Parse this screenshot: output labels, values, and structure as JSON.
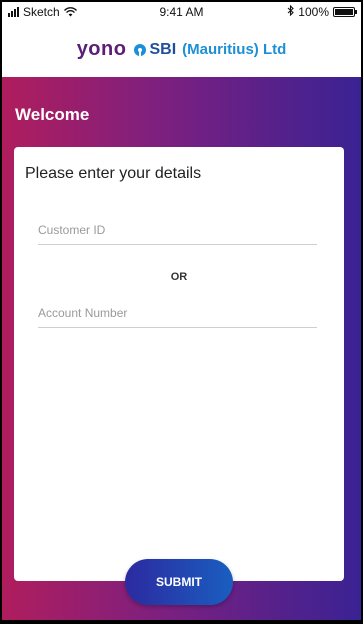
{
  "status_bar": {
    "carrier": "Sketch",
    "time": "9:41 AM",
    "battery": "100%",
    "battery_level": 1.0
  },
  "header": {
    "logo_yono": "yono",
    "logo_sbi": "SBI",
    "logo_suffix": "(Mauritius) Ltd"
  },
  "welcome": "Welcome",
  "form": {
    "title": "Please enter your details",
    "customer_id_placeholder": "Customer ID",
    "customer_id_value": "",
    "or_label": "OR",
    "account_number_placeholder": "Account Number",
    "account_number_value": "",
    "submit_label": "SUBMIT"
  },
  "colors": {
    "gradient_start": "#b01d5d",
    "gradient_end": "#3a2293",
    "button_start": "#2c2aa0",
    "button_end": "#1a5ec0",
    "yono_purple": "#5b1f78",
    "sbi_blue": "#1d8fd6"
  },
  "icons": [
    "signal-icon",
    "wifi-icon",
    "bluetooth-icon",
    "battery-icon",
    "sbi-logo-icon"
  ]
}
